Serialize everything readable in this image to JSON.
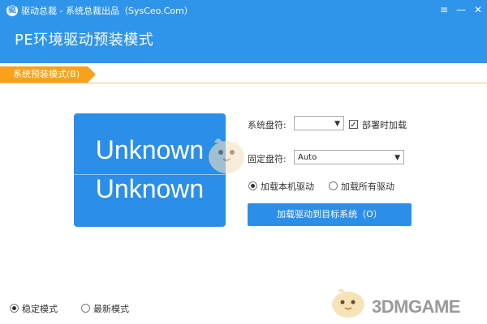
{
  "window": {
    "title": "驱动总裁 - 系统总裁出品（SysCeo.Com）",
    "headline": "PE环境驱动预装模式"
  },
  "mode_tab": {
    "label": "系统预装模式(B)"
  },
  "status_tile": {
    "line1": "Unknown",
    "line2": "Unknown"
  },
  "form": {
    "system_drive_label": "系统盘符:",
    "system_drive_value": "",
    "temp_load_label": "部署时加载",
    "temp_load_checked": true,
    "fixed_drive_label": "固定盘符:",
    "fixed_drive_value": "Auto",
    "radio_local_label": "加载本机驱动",
    "radio_all_label": "加载所有驱动",
    "load_button_label": "加载驱动到目标系统（O）"
  },
  "footer": {
    "stable_mode_label": "稳定模式",
    "latest_mode_label": "最新模式"
  },
  "watermark": {
    "logo_text": "3DMGAME"
  },
  "colors": {
    "titlebar": "#2f95ea",
    "accent_blue": "#2b8ee8",
    "tab_orange": "#f7a21a"
  },
  "icons": {
    "app": "driver-app-icon",
    "menu": "menu-icon",
    "minimize": "minimize-icon",
    "close": "close-icon",
    "mascot": "bird-mascot-icon"
  }
}
